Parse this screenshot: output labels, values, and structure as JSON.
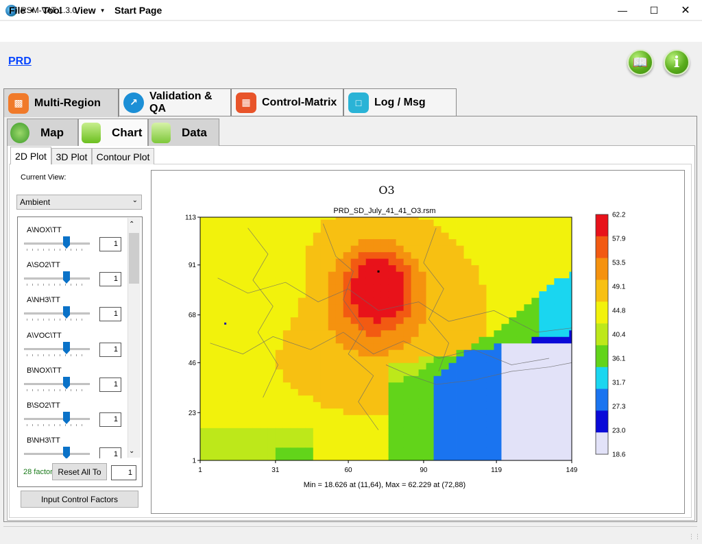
{
  "window": {
    "title": "RSM-VAT 1.3.0"
  },
  "menu": {
    "items": [
      {
        "label": "File",
        "has_dropdown": true
      },
      {
        "label": "Tool",
        "has_dropdown": false
      },
      {
        "label": "View",
        "has_dropdown": true
      },
      {
        "label": "Start Page",
        "has_dropdown": false
      }
    ]
  },
  "header": {
    "region_link": "PRD"
  },
  "main_tabs": [
    {
      "label": "Multi-Region",
      "icon": "bar-chart-icon",
      "color": "#f07a2a",
      "active": true
    },
    {
      "label": "Validation & QA",
      "icon": "line-chart-icon",
      "color": "#1c8fd6",
      "active": false
    },
    {
      "label": "Control-Matrix",
      "icon": "grid-table-icon",
      "color": "#e8542a",
      "active": false
    },
    {
      "label": "Log / Msg",
      "icon": "notebook-icon",
      "color": "#2ab3d6",
      "active": false
    }
  ],
  "sub_tabs": [
    {
      "label": "Map",
      "icon": "globe-icon",
      "active": false
    },
    {
      "label": "Chart",
      "icon": "bar-chart-icon",
      "active": true
    },
    {
      "label": "Data",
      "icon": "sheet-icon",
      "active": false
    }
  ],
  "plot_tabs": [
    {
      "label": "2D Plot",
      "active": true
    },
    {
      "label": "3D Plot",
      "active": false
    },
    {
      "label": "Contour Plot",
      "active": false
    }
  ],
  "left_panel": {
    "current_view_label": "Current View:",
    "view_value": "Ambient",
    "factors": [
      {
        "name": "A\\NOX\\TT",
        "value": "1"
      },
      {
        "name": "A\\SO2\\TT",
        "value": "1"
      },
      {
        "name": "A\\NH3\\TT",
        "value": "1"
      },
      {
        "name": "A\\VOC\\TT",
        "value": "1"
      },
      {
        "name": "B\\NOX\\TT",
        "value": "1"
      },
      {
        "name": "B\\SO2\\TT",
        "value": "1"
      },
      {
        "name": "B\\NH3\\TT",
        "value": "1"
      }
    ],
    "factor_count": "28 factors",
    "reset_label": "Reset All To",
    "reset_value": "1",
    "input_button": "Input Control Factors"
  },
  "chart_data": {
    "type": "heatmap",
    "title": "O3",
    "subtitle": "PRD_SD_July_41_41_O3.rsm",
    "x_ticks": [
      "1",
      "31",
      "60",
      "90",
      "119",
      "149"
    ],
    "y_ticks": [
      "1",
      "23",
      "46",
      "68",
      "91",
      "113"
    ],
    "xlim": [
      1,
      149
    ],
    "ylim": [
      1,
      113
    ],
    "colorbar": {
      "labels": [
        "62.2",
        "57.9",
        "53.5",
        "49.1",
        "44.8",
        "40.4",
        "36.1",
        "31.7",
        "27.3",
        "23.0",
        "18.6"
      ],
      "colors": [
        "#e8121a",
        "#f25a12",
        "#f5920f",
        "#f7c012",
        "#f2f20c",
        "#bde81a",
        "#62d41a",
        "#1ad6f0",
        "#1a74f0",
        "#0a0ad8",
        "#e2e2f8"
      ]
    },
    "min_value": 18.626,
    "min_location": [
      11,
      64
    ],
    "max_value": 62.229,
    "max_location": [
      72,
      88
    ],
    "footer": "Min = 18.626 at (11,64), Max = 62.229 at (72,88)"
  }
}
